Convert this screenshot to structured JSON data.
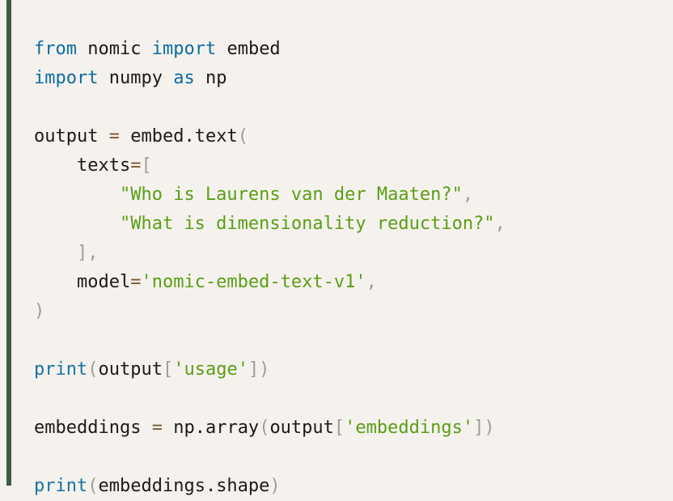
{
  "code_block": {
    "language": "python",
    "accent_color": "#3f5c40",
    "background_color": "#f5f2ee",
    "colors": {
      "keyword": "#0b6d9e",
      "function": "#1574a3",
      "string": "#5a9e14",
      "operator": "#7b5a32",
      "punctuation": "#9e9e99",
      "plain": "#1a1a1a"
    },
    "raw_text": "from nomic import embed\nimport numpy as np\n\noutput = embed.text(\n    texts=[\n        \"Who is Laurens van der Maaten?\",\n        \"What is dimensionality reduction?\",\n    ],\n    model='nomic-embed-text-v1',\n)\n\nprint(output['usage'])\n\nembeddings = np.array(output['embeddings'])\n\nprint(embeddings.shape)",
    "lines": [
      {
        "index": 1,
        "tokens": [
          {
            "text": "from",
            "type": "keyword"
          },
          {
            "text": " ",
            "type": "plain"
          },
          {
            "text": "nomic",
            "type": "plain"
          },
          {
            "text": " ",
            "type": "plain"
          },
          {
            "text": "import",
            "type": "keyword"
          },
          {
            "text": " ",
            "type": "plain"
          },
          {
            "text": "embed",
            "type": "plain"
          }
        ]
      },
      {
        "index": 2,
        "tokens": [
          {
            "text": "import",
            "type": "keyword"
          },
          {
            "text": " ",
            "type": "plain"
          },
          {
            "text": "numpy",
            "type": "plain"
          },
          {
            "text": " ",
            "type": "plain"
          },
          {
            "text": "as",
            "type": "keyword"
          },
          {
            "text": " ",
            "type": "plain"
          },
          {
            "text": "np",
            "type": "plain"
          }
        ]
      },
      {
        "index": 3,
        "tokens": []
      },
      {
        "index": 4,
        "tokens": [
          {
            "text": "output ",
            "type": "plain"
          },
          {
            "text": "=",
            "type": "operator"
          },
          {
            "text": " embed",
            "type": "plain"
          },
          {
            "text": ".",
            "type": "plain"
          },
          {
            "text": "text",
            "type": "plain"
          },
          {
            "text": "(",
            "type": "punctuation"
          }
        ]
      },
      {
        "index": 5,
        "tokens": [
          {
            "text": "    texts",
            "type": "plain"
          },
          {
            "text": "=",
            "type": "operator"
          },
          {
            "text": "[",
            "type": "punctuation"
          }
        ]
      },
      {
        "index": 6,
        "tokens": [
          {
            "text": "        ",
            "type": "plain"
          },
          {
            "text": "\"Who is Laurens van der Maaten?\"",
            "type": "string"
          },
          {
            "text": ",",
            "type": "punctuation"
          }
        ]
      },
      {
        "index": 7,
        "tokens": [
          {
            "text": "        ",
            "type": "plain"
          },
          {
            "text": "\"What is dimensionality reduction?\"",
            "type": "string"
          },
          {
            "text": ",",
            "type": "punctuation"
          }
        ]
      },
      {
        "index": 8,
        "tokens": [
          {
            "text": "    ",
            "type": "plain"
          },
          {
            "text": "],",
            "type": "punctuation"
          }
        ]
      },
      {
        "index": 9,
        "tokens": [
          {
            "text": "    model",
            "type": "plain"
          },
          {
            "text": "=",
            "type": "operator"
          },
          {
            "text": "'nomic-embed-text-v1'",
            "type": "string"
          },
          {
            "text": ",",
            "type": "punctuation"
          }
        ]
      },
      {
        "index": 10,
        "tokens": [
          {
            "text": ")",
            "type": "punctuation"
          }
        ]
      },
      {
        "index": 11,
        "tokens": []
      },
      {
        "index": 12,
        "tokens": [
          {
            "text": "print",
            "type": "function"
          },
          {
            "text": "(",
            "type": "punctuation"
          },
          {
            "text": "output",
            "type": "plain"
          },
          {
            "text": "[",
            "type": "punctuation"
          },
          {
            "text": "'usage'",
            "type": "string"
          },
          {
            "text": "])",
            "type": "punctuation"
          }
        ]
      },
      {
        "index": 13,
        "tokens": []
      },
      {
        "index": 14,
        "tokens": [
          {
            "text": "embeddings ",
            "type": "plain"
          },
          {
            "text": "=",
            "type": "operator"
          },
          {
            "text": " np",
            "type": "plain"
          },
          {
            "text": ".",
            "type": "plain"
          },
          {
            "text": "array",
            "type": "plain"
          },
          {
            "text": "(",
            "type": "punctuation"
          },
          {
            "text": "output",
            "type": "plain"
          },
          {
            "text": "[",
            "type": "punctuation"
          },
          {
            "text": "'embeddings'",
            "type": "string"
          },
          {
            "text": "])",
            "type": "punctuation"
          }
        ]
      },
      {
        "index": 15,
        "tokens": []
      },
      {
        "index": 16,
        "tokens": [
          {
            "text": "print",
            "type": "function"
          },
          {
            "text": "(",
            "type": "punctuation"
          },
          {
            "text": "embeddings",
            "type": "plain"
          },
          {
            "text": ".",
            "type": "plain"
          },
          {
            "text": "shape",
            "type": "plain"
          },
          {
            "text": ")",
            "type": "punctuation"
          }
        ]
      }
    ]
  }
}
